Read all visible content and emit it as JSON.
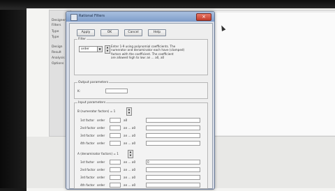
{
  "dialog": {
    "title": "Rational Filters",
    "buttons": [
      "Apply",
      "OK",
      "Cancel",
      "Help"
    ]
  },
  "background": {
    "tree_items": [
      "Designer",
      "Filters",
      "Type",
      "Type",
      "Design",
      "Result",
      "Analysis",
      "Options"
    ]
  },
  "filter_group": {
    "label": "Filter",
    "combo_value": "order",
    "note": [
      "Enter 1-9 using polynomial coefficients. The",
      "numerator and denominator each have (clamped)",
      "factors with the coefficient. The coefficient",
      "are allowed high to low: an ... a0, a0"
    ]
  },
  "output_group": {
    "label": "Output parameters",
    "k_label": "K:",
    "k_value": ""
  },
  "input_group": {
    "label": "Input parameters",
    "numerator": {
      "label": "B (numerator factors) = 1",
      "rows": [
        {
          "name": "1st factor",
          "order": "order",
          "coef": "a0"
        },
        {
          "name": "2nd factor",
          "order": "order",
          "coef": "an ... a0"
        },
        {
          "name": "3rd factor",
          "order": "order",
          "coef": "an ... a0"
        },
        {
          "name": "4th factor",
          "order": "order",
          "coef": "an ... a0"
        }
      ]
    },
    "denominator": {
      "label": "A (denominator factors) = 1",
      "rows": [
        {
          "name": "1st factor",
          "order": "order",
          "coef": "an ... a0",
          "value": "0"
        },
        {
          "name": "2nd factor",
          "order": "order",
          "coef": "an ... a0",
          "value": ""
        },
        {
          "name": "3rd factor",
          "order": "order",
          "coef": "an ... a0",
          "value": ""
        },
        {
          "name": "4th factor",
          "order": "order",
          "coef": "an ... a0",
          "value": ""
        }
      ]
    }
  }
}
